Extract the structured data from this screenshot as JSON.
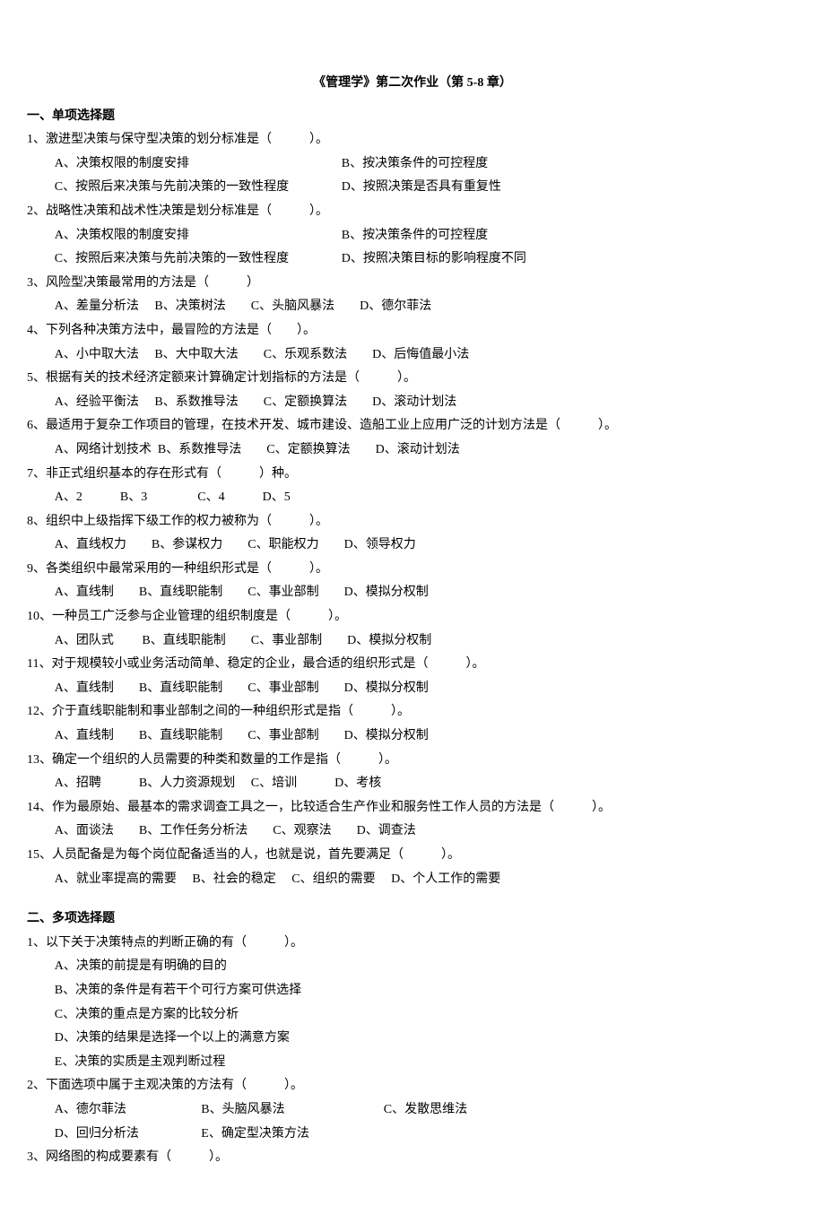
{
  "title": "《管理学》第二次作业（第 5-8 章）",
  "section1_heading": "一、单项选择题",
  "q1": {
    "stem": "1、激进型决策与保守型决策的划分标准是（　　　）。",
    "a": "A、决策权限的制度安排",
    "b": "B、按决策条件的可控程度",
    "c": "C、按照后来决策与先前决策的一致性程度",
    "d": "D、按照决策是否具有重复性"
  },
  "q2": {
    "stem": "2、战略性决策和战术性决策是划分标准是（　　　）。",
    "a": "A、决策权限的制度安排",
    "b": "B、按决策条件的可控程度",
    "c": "C、按照后来决策与先前决策的一致性程度",
    "d": "D、按照决策目标的影响程度不同"
  },
  "q3": {
    "stem": "3、风险型决策最常用的方法是（　　　）",
    "opts": "A、差量分析法　 B、决策树法　　C、头脑风暴法　　D、德尔菲法"
  },
  "q4": {
    "stem": "4、下列各种决策方法中，最冒险的方法是（　　）。",
    "opts": "A、小中取大法　 B、大中取大法　　C、乐观系数法　　D、后悔值最小法"
  },
  "q5": {
    "stem": "5、根据有关的技术经济定额来计算确定计划指标的方法是（　　　）。",
    "opts": "A、经验平衡法　 B、系数推导法　　C、定额换算法　　D、滚动计划法"
  },
  "q6": {
    "stem": "6、最适用于复杂工作项目的管理，在技术开发、城市建设、造船工业上应用广泛的计划方法是（　　　）。",
    "opts": "A、网络计划技术  B、系数推导法　　C、定额换算法　　D、滚动计划法"
  },
  "q7": {
    "stem": "7、非正式组织基本的存在形式有（　　　）种。",
    "opts": "A、2　　　B、3　　　　C、4　　　D、5"
  },
  "q8": {
    "stem": "8、组织中上级指挥下级工作的权力被称为（　　　）。",
    "opts": "A、直线权力　　B、参谋权力　　C、职能权力　　D、领导权力"
  },
  "q9": {
    "stem": "9、各类组织中最常采用的一种组织形式是（　　　）。",
    "opts": "A、直线制　　B、直线职能制　　C、事业部制　　D、模拟分权制"
  },
  "q10": {
    "stem": "10、一种员工广泛参与企业管理的组织制度是（　　　）。",
    "opts": "A、团队式　　 B、直线职能制　　C、事业部制　　D、模拟分权制"
  },
  "q11": {
    "stem": "11、对于规模较小或业务活动简单、稳定的企业，最合适的组织形式是（　　　）。",
    "opts": "A、直线制　　B、直线职能制　　C、事业部制　　D、模拟分权制"
  },
  "q12": {
    "stem": "12、介于直线职能制和事业部制之间的一种组织形式是指（　　　）。",
    "opts": "A、直线制　　B、直线职能制　　C、事业部制　　D、模拟分权制"
  },
  "q13": {
    "stem": "13、确定一个组织的人员需要的种类和数量的工作是指（　　　）。",
    "opts": "A、招聘　　　B、人力资源规划　 C、培训　　　D、考核"
  },
  "q14": {
    "stem": "14、作为最原始、最基本的需求调查工具之一，比较适合生产作业和服务性工作人员的方法是（　　　）。",
    "opts": "A、面谈法　　B、工作任务分析法　　C、观察法　　D、调查法"
  },
  "q15": {
    "stem": "15、人员配备是为每个岗位配备适当的人，也就是说，首先要满足（　　　）。",
    "opts": "A、就业率提高的需要　 B、社会的稳定　 C、组织的需要　 D、个人工作的需要"
  },
  "section2_heading": "二、多项选择题",
  "mq1": {
    "stem": "1、以下关于决策特点的判断正确的有（　　　）。",
    "a": "A、决策的前提是有明确的目的",
    "b": "B、决策的条件是有若干个可行方案可供选择",
    "c": "C、决策的重点是方案的比较分析",
    "d": "D、决策的结果是选择一个以上的满意方案",
    "e": "E、决策的实质是主观判断过程"
  },
  "mq2": {
    "stem": "2、下面选项中属于主观决策的方法有（　　　）。",
    "line1a": "A、德尔菲法",
    "line1b": "B、头脑风暴法",
    "line1c": "C、发散思维法",
    "line2a": "D、回归分析法",
    "line2b": "E、确定型决策方法"
  },
  "mq3": {
    "stem": "3、网络图的构成要素有（　　　）。"
  }
}
